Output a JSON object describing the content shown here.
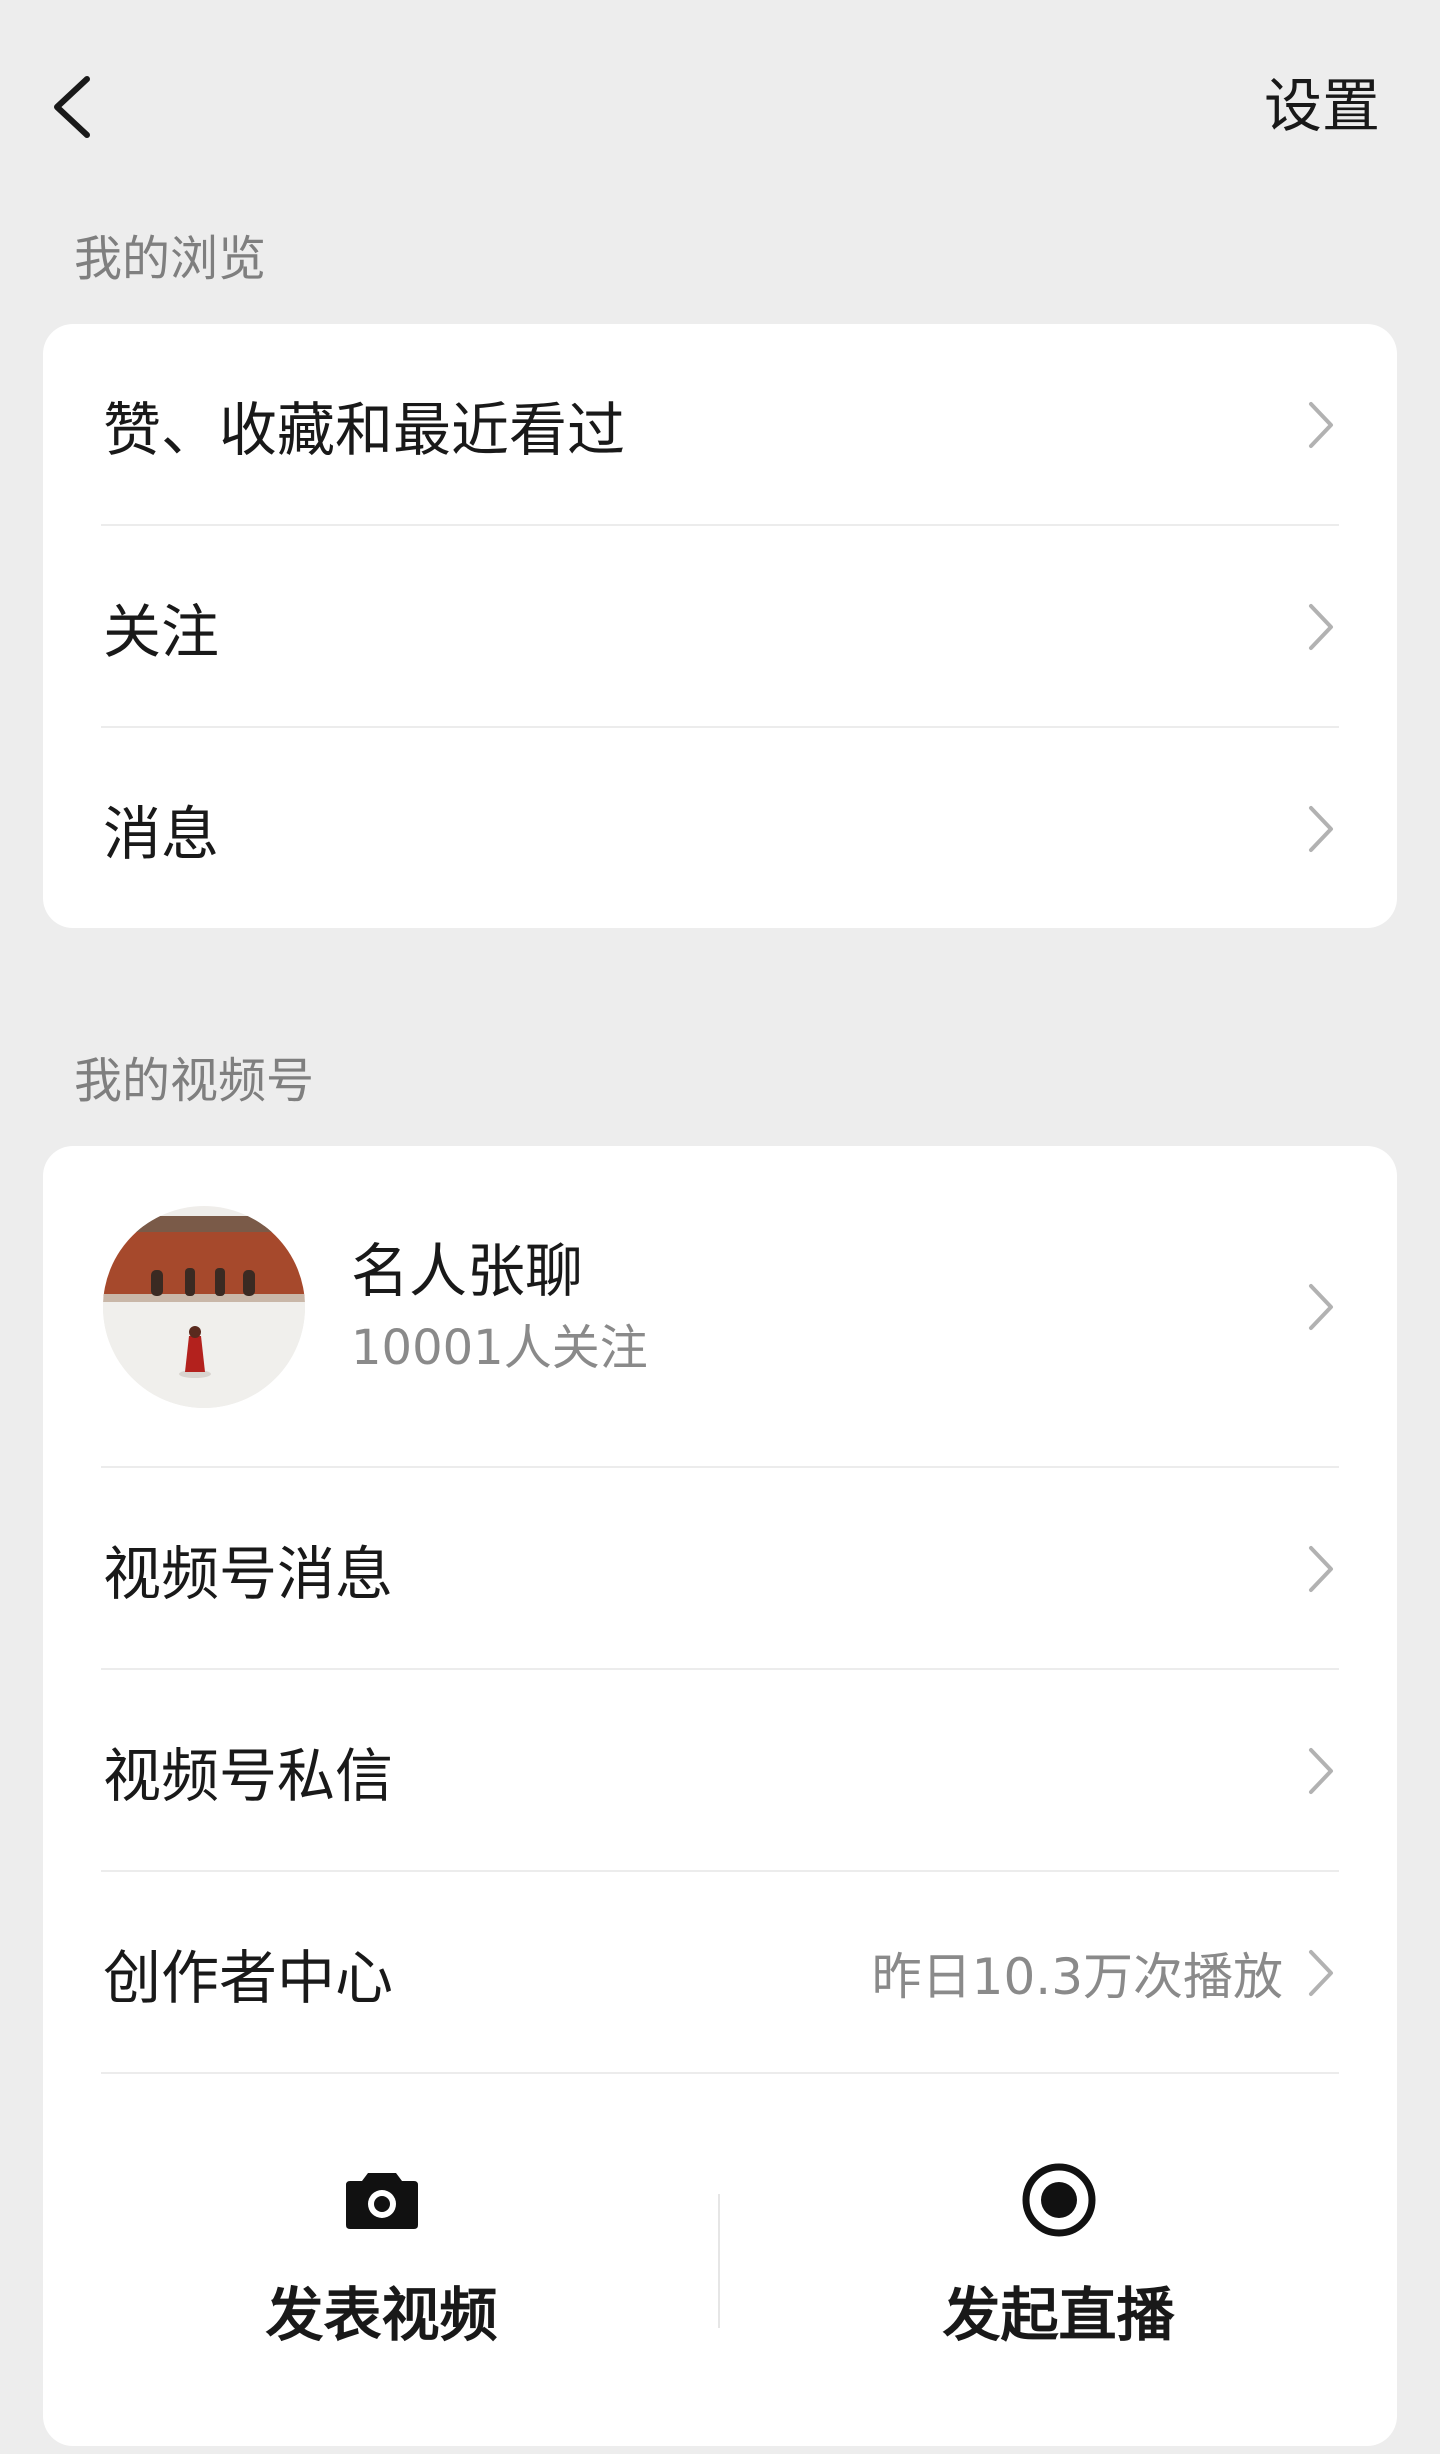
{
  "header": {
    "back_label": "",
    "settings_label": "设置"
  },
  "browse_section": {
    "title": "我的浏览",
    "items": [
      {
        "label": "赞、收藏和最近看过"
      },
      {
        "label": "关注"
      },
      {
        "label": "消息"
      }
    ]
  },
  "channels_section": {
    "title": "我的视频号",
    "profile": {
      "name": "名人张聊",
      "followers": "10001人关注"
    },
    "items": [
      {
        "label": "视频号消息",
        "extra": ""
      },
      {
        "label": "视频号私信",
        "extra": ""
      },
      {
        "label": "创作者中心",
        "extra": "昨日10.3万次播放"
      }
    ],
    "actions": [
      {
        "label": "发表视频",
        "icon": "camera-icon"
      },
      {
        "label": "发起直播",
        "icon": "live-record-icon"
      }
    ]
  },
  "colors": {
    "background": "#ededed",
    "card": "#ffffff",
    "text_primary": "#191919",
    "text_secondary": "#7f7f7f",
    "chevron": "#b2b2b2"
  }
}
